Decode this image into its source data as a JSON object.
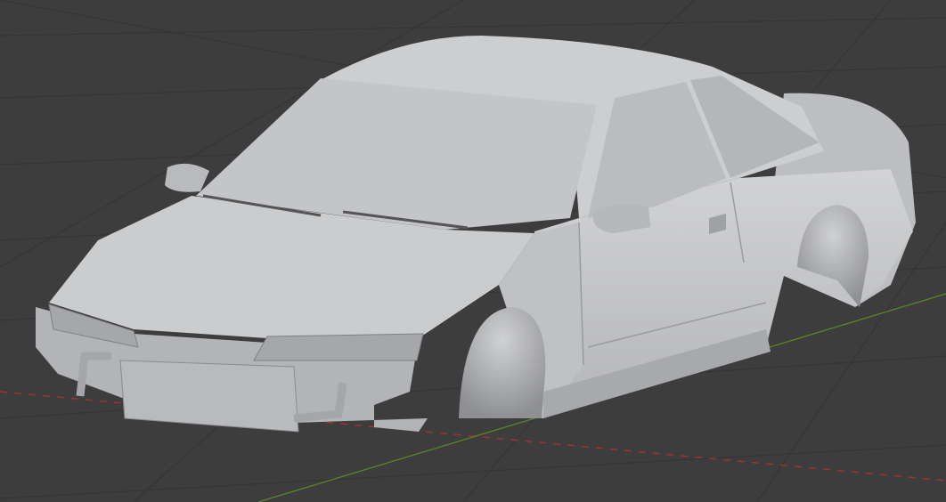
{
  "viewport": {
    "background": "#3d3d3d",
    "grid_color": "#353535",
    "axis_x_color": "#9c3434",
    "axis_y_color": "#5a8a2a",
    "body_color": "#c9cacc",
    "body_shade": "#a9aaad",
    "body_dark": "#8c8d90",
    "glass_color": "#b8b9bc"
  }
}
